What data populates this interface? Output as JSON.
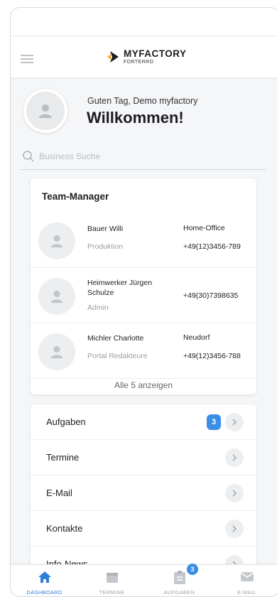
{
  "header": {
    "logo_title": "MYFACTORY",
    "logo_sub": "FORTERRO"
  },
  "welcome": {
    "greeting": "Guten Tag, Demo myfactory",
    "title": "Willkommen!"
  },
  "search": {
    "placeholder": "Business Suche"
  },
  "team_manager": {
    "title": "Team-Manager",
    "members": [
      {
        "name": "Bauer Willi",
        "role": "Produktion",
        "location": "Home-Office",
        "phone": "+49(12)3456-789"
      },
      {
        "name": "Heimwerker Jürgen Schulze",
        "role": "Admin",
        "location": "",
        "phone": "+49(30)7398635"
      },
      {
        "name": "Michler Charlotte",
        "role": "Portal Redakteure",
        "location": "Neudorf",
        "phone": "+49(12)3456-788"
      }
    ],
    "show_all": "Alle 5 anzeigen"
  },
  "menu": {
    "items": [
      {
        "label": "Aufgaben",
        "badge": "3"
      },
      {
        "label": "Termine",
        "badge": ""
      },
      {
        "label": "E-Mail",
        "badge": ""
      },
      {
        "label": "Kontakte",
        "badge": ""
      },
      {
        "label": "Info-News",
        "badge": ""
      }
    ]
  },
  "bottom_nav": {
    "items": [
      {
        "label": "DASHBOARD",
        "icon": "home-icon",
        "active": true
      },
      {
        "label": "TERMINE",
        "icon": "calendar-icon",
        "active": false
      },
      {
        "label": "AUFGABEN",
        "icon": "clipboard-icon",
        "active": false,
        "badge": "3"
      },
      {
        "label": "E-MAIL",
        "icon": "mail-icon",
        "active": false
      }
    ]
  },
  "colors": {
    "accent": "#3a8ee6",
    "active_nav": "#2f7fd8",
    "background": "#f5f6f8"
  }
}
